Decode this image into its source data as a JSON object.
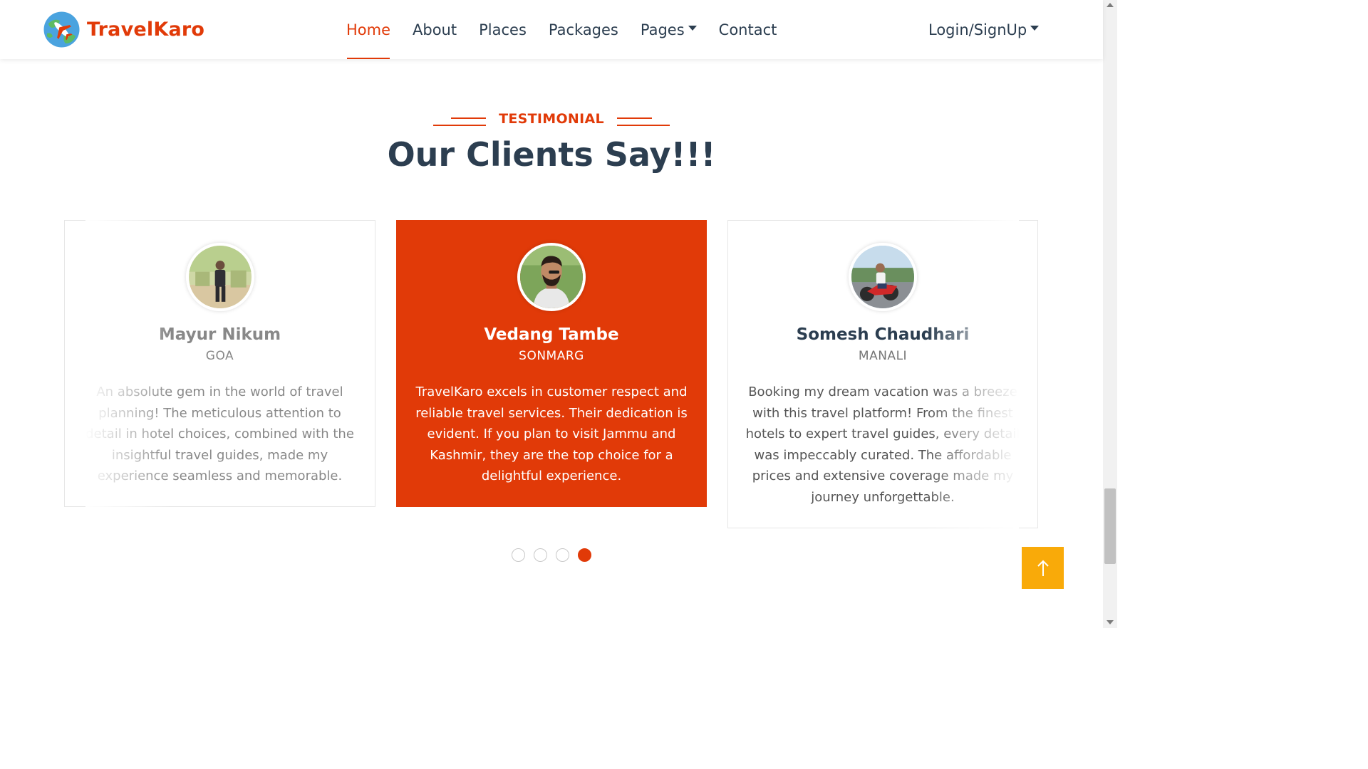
{
  "brand": {
    "name": "TravelKaro",
    "logo_icon": "globe-airplane-icon"
  },
  "nav": {
    "items": [
      {
        "label": "Home",
        "active": true
      },
      {
        "label": "About",
        "active": false
      },
      {
        "label": "Places",
        "active": false
      },
      {
        "label": "Packages",
        "active": false
      },
      {
        "label": "Pages",
        "active": false,
        "dropdown": true
      },
      {
        "label": "Contact",
        "active": false
      }
    ],
    "login_label": "Login/SignUp"
  },
  "section": {
    "tag": "TESTIMONIAL",
    "title": "Our Clients Say!!!"
  },
  "testimonials": [
    {
      "name": "Mayur Nikum",
      "place": "GOA",
      "text": "An absolute gem in the world of travel planning! The meticulous attention to detail in hotel choices, combined with the insightful travel guides, made my experience seamless and memorable."
    },
    {
      "name": "Vedang Tambe",
      "place": "SONMARG",
      "text": "TravelKaro excels in customer respect and reliable travel services. Their dedication is evident. If you plan to visit Jammu and Kashmir, they are the top choice for a delightful experience."
    },
    {
      "name": "Somesh Chaudhari",
      "place": "MANALI",
      "text": "Booking my dream vacation was a breeze with this travel platform! From the finest hotels to expert travel guides, every detail was impeccably curated. The affordable prices and extensive coverage made my journey unforgettable."
    }
  ],
  "carousel": {
    "dot_count": 4,
    "active_dot": 4
  },
  "colors": {
    "accent": "#e13a08",
    "heading": "#2c3e50",
    "back_to_top": "#f9aa09"
  },
  "back_to_top": {
    "icon": "arrow-up-icon"
  }
}
